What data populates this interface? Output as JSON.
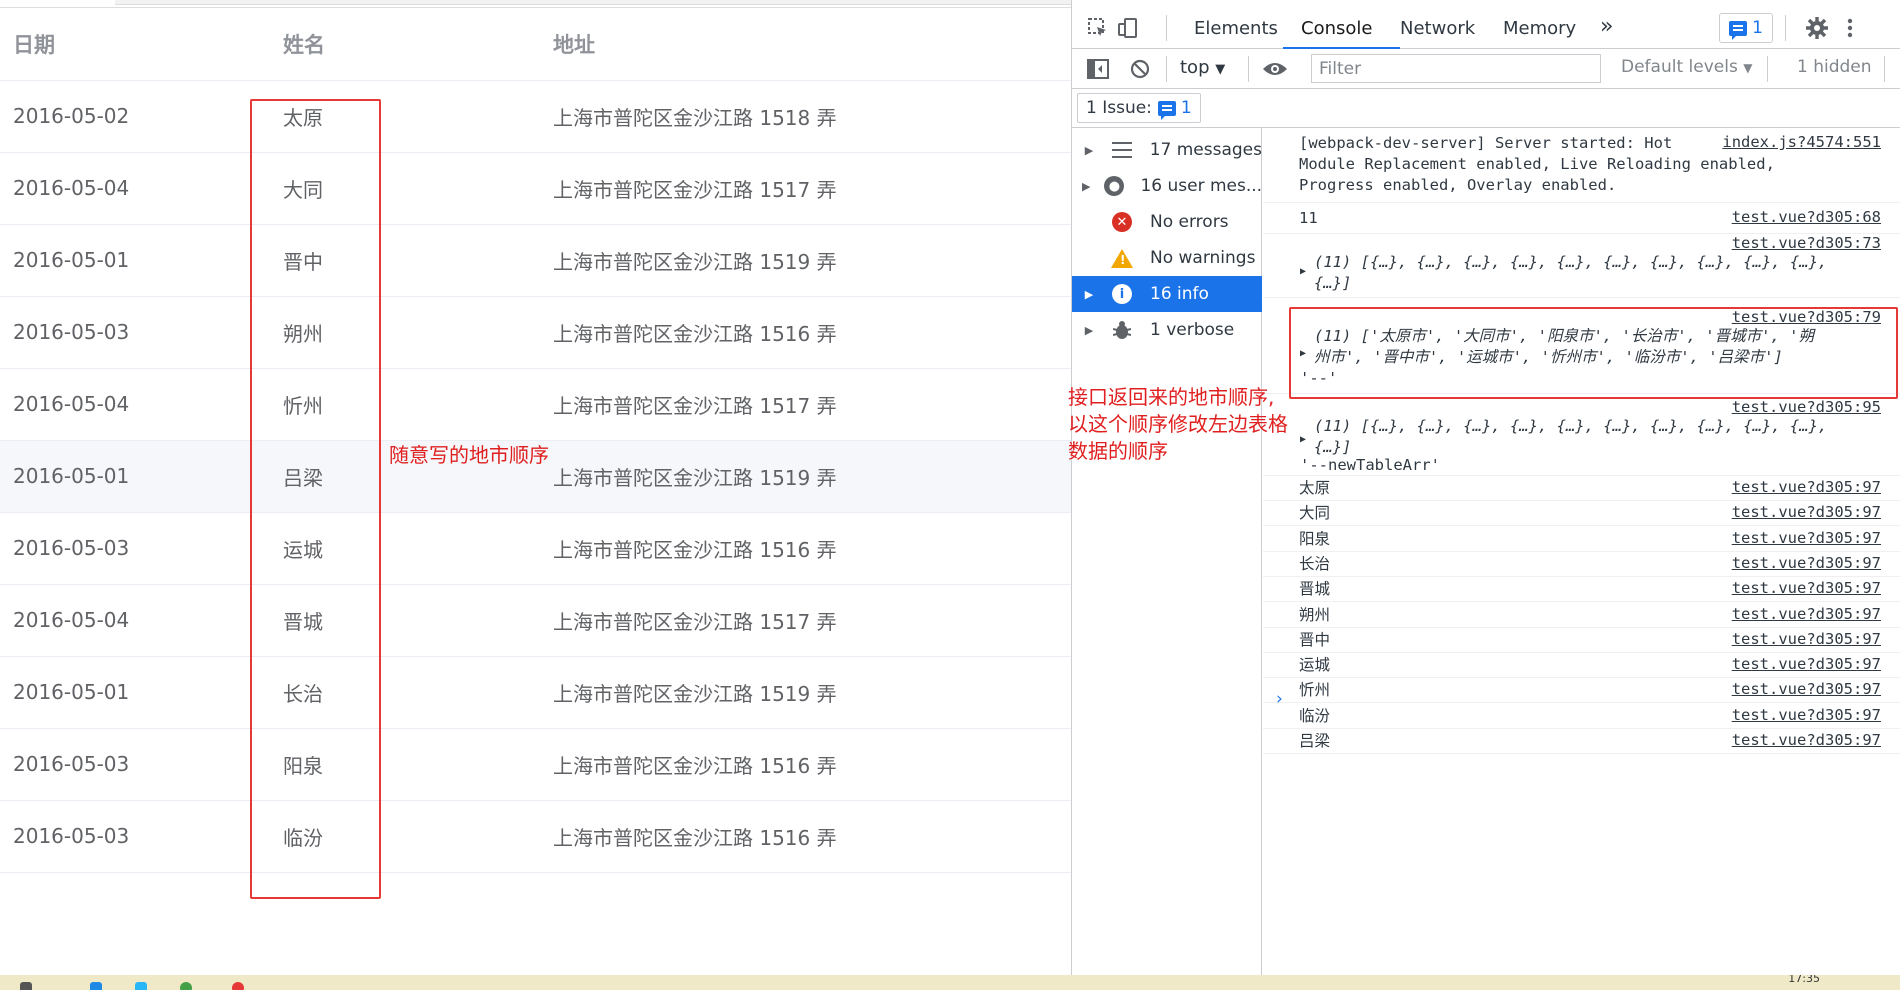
{
  "table": {
    "headers": [
      "日期",
      "姓名",
      "地址"
    ],
    "rows": [
      {
        "date": "2016-05-02",
        "name": "太原",
        "address": "上海市普陀区金沙江路 1518 弄"
      },
      {
        "date": "2016-05-04",
        "name": "大同",
        "address": "上海市普陀区金沙江路 1517 弄"
      },
      {
        "date": "2016-05-01",
        "name": "晋中",
        "address": "上海市普陀区金沙江路 1519 弄"
      },
      {
        "date": "2016-05-03",
        "name": "朔州",
        "address": "上海市普陀区金沙江路 1516 弄"
      },
      {
        "date": "2016-05-04",
        "name": "忻州",
        "address": "上海市普陀区金沙江路 1517 弄"
      },
      {
        "date": "2016-05-01",
        "name": "吕梁",
        "address": "上海市普陀区金沙江路 1519 弄"
      },
      {
        "date": "2016-05-03",
        "name": "运城",
        "address": "上海市普陀区金沙江路 1516 弄"
      },
      {
        "date": "2016-05-04",
        "name": "晋城",
        "address": "上海市普陀区金沙江路 1517 弄"
      },
      {
        "date": "2016-05-01",
        "name": "长治",
        "address": "上海市普陀区金沙江路 1519 弄"
      },
      {
        "date": "2016-05-03",
        "name": "阳泉",
        "address": "上海市普陀区金沙江路 1516 弄"
      },
      {
        "date": "2016-05-03",
        "name": "临汾",
        "address": "上海市普陀区金沙江路 1516 弄"
      }
    ]
  },
  "annotations": {
    "left": "随意写的地市顺序",
    "right_lines": [
      "接口返回来的地市顺序,",
      "以这个顺序修改左边表格",
      "数据的顺序"
    ]
  },
  "devtools": {
    "tabs": [
      "Elements",
      "Console",
      "Network",
      "Memory"
    ],
    "more": "»",
    "issue_chip_count": "1",
    "context": "top",
    "filter_placeholder": "Filter",
    "levels": "Default levels",
    "hidden": "1 hidden",
    "issues_label": "1 Issue:",
    "issues_count": "1",
    "sidebar": [
      {
        "label": "17 messages",
        "icon": "list-icon"
      },
      {
        "label": "16 user mes...",
        "icon": "user-icon"
      },
      {
        "label": "No errors",
        "icon": "error-icon"
      },
      {
        "label": "No warnings",
        "icon": "warning-icon"
      },
      {
        "label": "16 info",
        "icon": "info-icon"
      },
      {
        "label": "1 verbose",
        "icon": "bug-icon"
      }
    ],
    "console": {
      "server_msg": [
        "[webpack-dev-server] Server started: Hot",
        "Module Replacement enabled, Live Reloading enabled,",
        "Progress enabled, Overlay enabled."
      ],
      "server_src": "index.js?4574:551",
      "count_value": "11",
      "count_src": "test.vue?d305:68",
      "arr1_src": "test.vue?d305:73",
      "arr1_lines": [
        "(11) [{…}, {…}, {…}, {…}, {…}, {…}, {…}, {…}, {…}, {…},",
        "{…}]"
      ],
      "arr2_src": "test.vue?d305:79",
      "arr2_lines": [
        "(11) ['太原市', '大同市', '阳泉市', '长治市', '晋城市', '朔",
        "州市', '晋中市', '运城市', '忻州市', '临汾市', '吕梁市']"
      ],
      "arr2_tail": "'--'",
      "arr3_src": "test.vue?d305:95",
      "arr3_lines": [
        "(11) [{…}, {…}, {…}, {…}, {…}, {…}, {…}, {…}, {…}, {…},",
        "{…}]"
      ],
      "arr3_tail": "'--newTableArr'",
      "city_src": "test.vue?d305:97",
      "cities": [
        "太原",
        "大同",
        "阳泉",
        "长治",
        "晋城",
        "朔州",
        "晋中",
        "运城",
        "忻州",
        "临汾",
        "吕梁"
      ],
      "prompt": "›"
    }
  },
  "taskbar": {
    "clock": "17:35"
  }
}
